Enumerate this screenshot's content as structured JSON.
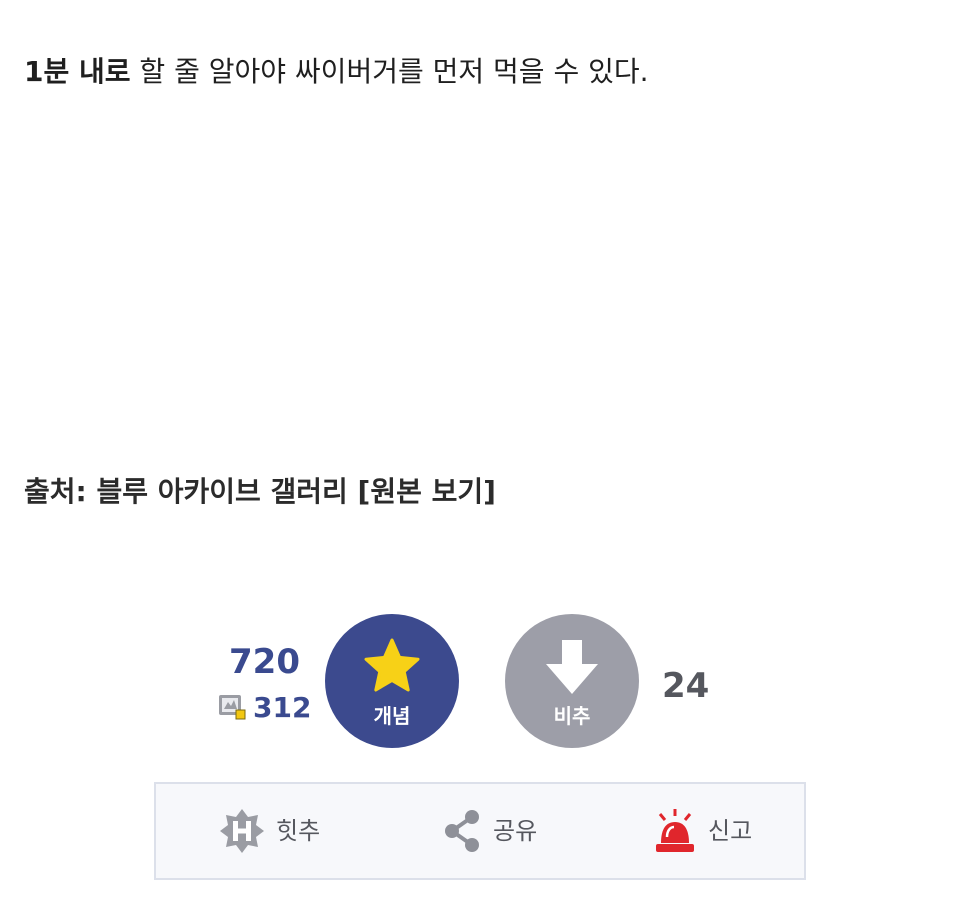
{
  "post": {
    "bold_text": "1분 내로",
    "rest_text": " 할 줄 알아야 싸이버거를 먼저 먹을 수 있다."
  },
  "source": {
    "text": "출처: 블루 아카이브 갤러리 [원본 보기]"
  },
  "votes": {
    "up_count": "720",
    "gonik_count": "312",
    "up_label": "개념",
    "down_label": "비추",
    "down_count": "24"
  },
  "actions": {
    "hit_label": "힛추",
    "share_label": "공유",
    "report_label": "신고"
  },
  "colors": {
    "up_button": "#3c4a8e",
    "down_button": "#9d9ea8",
    "up_count": "#3a4a8f",
    "star": "#f7d117",
    "report_icon": "#e0262c"
  },
  "icons": {
    "up": "star-icon",
    "down": "arrow-down-icon",
    "gonik": "gonik-icon",
    "hit": "hit-badge-icon",
    "share": "share-icon",
    "report": "siren-icon"
  }
}
